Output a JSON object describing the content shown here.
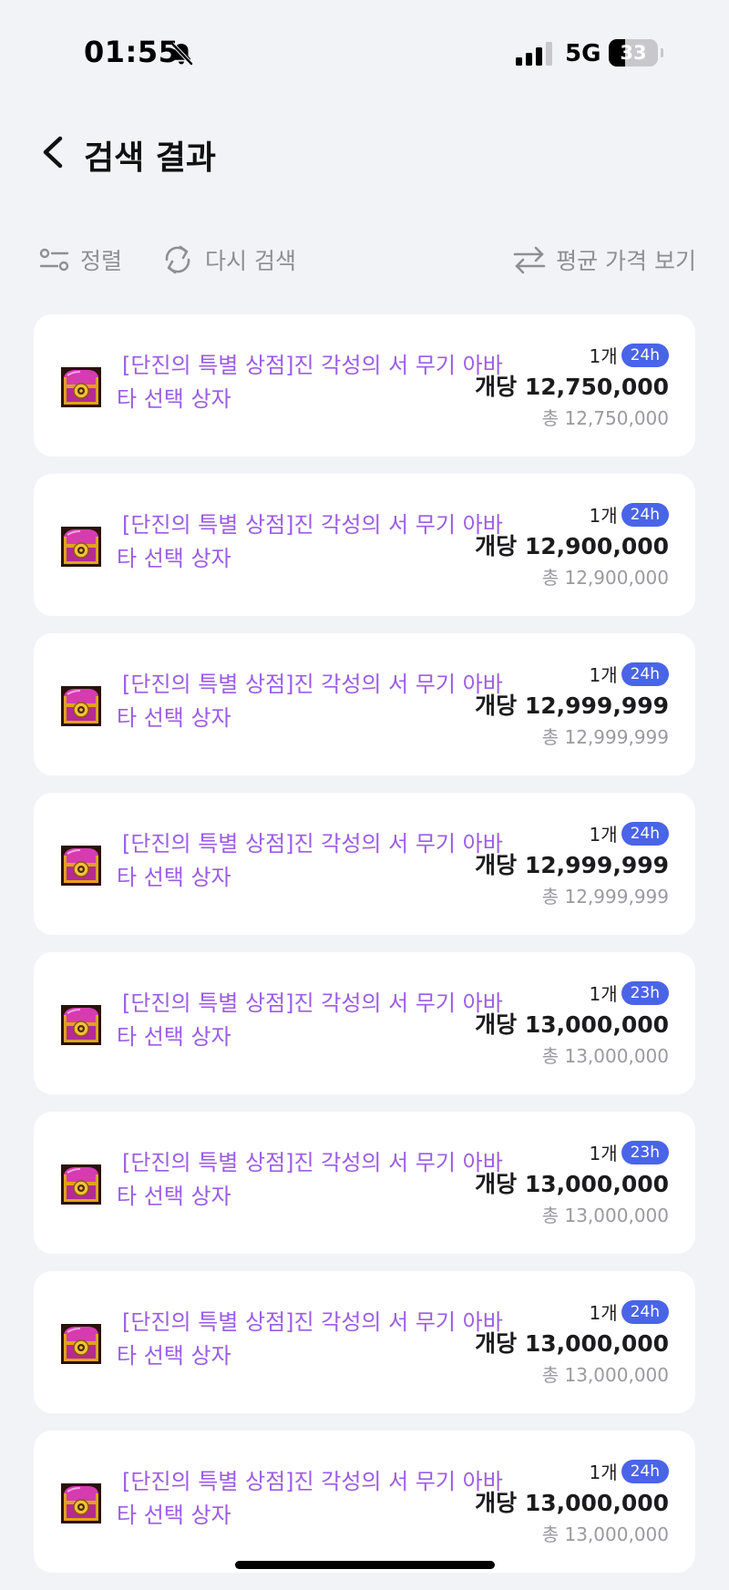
{
  "status_bar": {
    "time": "01:55",
    "network": "5G",
    "battery_level": "33"
  },
  "header": {
    "title": "검색 결과"
  },
  "toolbar": {
    "sort_label": "정렬",
    "research_label": "다시 검색",
    "avg_price_label": "평균 가격 보기"
  },
  "results": [
    {
      "name": "[단진의 특별 상점]진 각성의 서 무기 아바타 선택 상자",
      "qty": "1개",
      "time_left": "24h",
      "unit_price": "개당 12,750,000",
      "total_price": "총 12,750,000"
    },
    {
      "name": "[단진의 특별 상점]진 각성의 서 무기 아바타 선택 상자",
      "qty": "1개",
      "time_left": "24h",
      "unit_price": "개당 12,900,000",
      "total_price": "총 12,900,000"
    },
    {
      "name": "[단진의 특별 상점]진 각성의 서 무기 아바타 선택 상자",
      "qty": "1개",
      "time_left": "24h",
      "unit_price": "개당 12,999,999",
      "total_price": "총 12,999,999"
    },
    {
      "name": "[단진의 특별 상점]진 각성의 서 무기 아바타 선택 상자",
      "qty": "1개",
      "time_left": "24h",
      "unit_price": "개당 12,999,999",
      "total_price": "총 12,999,999"
    },
    {
      "name": "[단진의 특별 상점]진 각성의 서 무기 아바타 선택 상자",
      "qty": "1개",
      "time_left": "23h",
      "unit_price": "개당 13,000,000",
      "total_price": "총 13,000,000"
    },
    {
      "name": "[단진의 특별 상점]진 각성의 서 무기 아바타 선택 상자",
      "qty": "1개",
      "time_left": "23h",
      "unit_price": "개당 13,000,000",
      "total_price": "총 13,000,000"
    },
    {
      "name": "[단진의 특별 상점]진 각성의 서 무기 아바타 선택 상자",
      "qty": "1개",
      "time_left": "24h",
      "unit_price": "개당 13,000,000",
      "total_price": "총 13,000,000"
    },
    {
      "name": "[단진의 특별 상점]진 각성의 서 무기 아바타 선택 상자",
      "qty": "1개",
      "time_left": "24h",
      "unit_price": "개당 13,000,000",
      "total_price": "총 13,000,000"
    }
  ],
  "colors": {
    "item_name": "#9b5de5",
    "badge": "#4a64e8",
    "background": "#f2f3f7"
  },
  "icons": {
    "item": "treasure-chest-icon",
    "back": "chevron-left-icon",
    "sort": "sort-icon",
    "research": "refresh-icon",
    "avg_price": "swap-arrows-icon"
  }
}
